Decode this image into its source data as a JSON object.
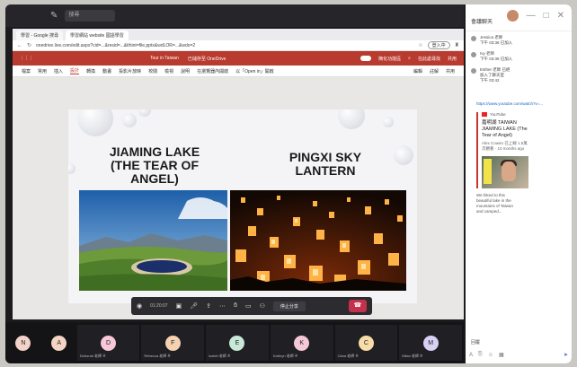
{
  "titlebar": {
    "search_placeholder": "搜尋",
    "minimize": "—",
    "maximize": "□",
    "close": "✕"
  },
  "browser": {
    "tabs": [
      "學習 - Google 搜尋",
      "學習網站 website 國語學習"
    ],
    "url": "onedrive.live.com/edit.aspx?cid=...&resid=...&ithint=file,pptx&wdLOR=...&wdo=2",
    "signin_label": "登入中"
  },
  "powerpoint": {
    "doc_name": "Tour in Taiwan",
    "save_status": "已儲存至 OneDrive",
    "toggle_label": "簡化功能區",
    "comment_label": "在此處尋找",
    "share_label": "共用",
    "ribbon": [
      "檔案",
      "常用",
      "插入",
      "設計",
      "轉換",
      "動畫",
      "投影片放映",
      "校閱",
      "檢視",
      "說明",
      "在瀏覽器內開啟",
      "以「Open in」開啟"
    ],
    "ribbon_active_index": 3,
    "ribbon_right": [
      "編輯",
      "註解",
      "共用"
    ]
  },
  "slide": {
    "left_title": "JIAMING LAKE\n(THE TEAR OF\nANGEL)",
    "right_title": "PINGXI SKY\nLANTERN"
  },
  "callbar": {
    "timer": "01:20:07",
    "share_label": "停止分享",
    "icons": [
      "camera-icon",
      "mic-icon",
      "share-tray-icon",
      "more-icon",
      "raise-hand-icon",
      "chat-icon",
      "people-icon",
      "leave-icon"
    ]
  },
  "participants": [
    {
      "initial": "N",
      "name": "",
      "color": "#f3d3c8",
      "size": "small"
    },
    {
      "initial": "A",
      "name": "",
      "color": "#f5d4c4",
      "size": "small"
    },
    {
      "initial": "D",
      "name": "Deborah 老師 ※",
      "color": "#f7c8d8",
      "size": "wide"
    },
    {
      "initial": "F",
      "name": "Rebecca 老師 ※",
      "color": "#f6d2b2",
      "size": "wide"
    },
    {
      "initial": "E",
      "name": "Isabel 老師 ※",
      "color": "#c8e8d8",
      "size": "wide"
    },
    {
      "initial": "K",
      "name": "Kathryn 老師 ※",
      "color": "#f4c8d6",
      "size": "wide"
    },
    {
      "initial": "C",
      "name": "Clara 老師 ※",
      "color": "#f8dcaa",
      "size": "wide"
    },
    {
      "initial": "M",
      "name": "Milan 老師 ※",
      "color": "#d8d0f5",
      "size": "wide"
    }
  ],
  "chat": {
    "title": "會議聊天",
    "messages": [
      {
        "text": "Jessica 老師\n下午 03:36 已加入"
      },
      {
        "text": "Ivy 老師\n下午 03:36 已加入"
      },
      {
        "text": "Esther 老師 已經\n加入了聊天室\n下午 03:42"
      }
    ],
    "link": "https://www.youtube.com/watch?v=...",
    "yt_site": "YouTube",
    "yt_title": "嘉明湖 TAIWAN\nJIAMING LAKE (The\nTear of Angel)",
    "yt_subtitle": "Alex Cowen 已上線 1.5萬\n次觀看 · 10 months ago",
    "yt_desc": "We hiked to this\nbeautiful lake in the\nmountains of Taiwan\nand camped...",
    "compose_label": "回覆",
    "send_icon": "send-icon"
  }
}
